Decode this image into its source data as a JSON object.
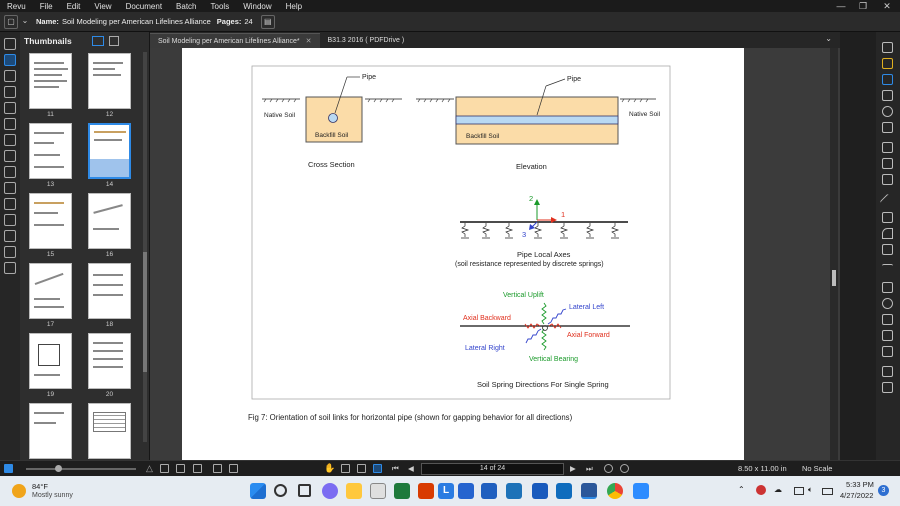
{
  "menu": {
    "items": [
      "Revu",
      "File",
      "Edit",
      "View",
      "Document",
      "Batch",
      "Tools",
      "Window",
      "Help"
    ]
  },
  "window_controls": {
    "minimize": "—",
    "restore": "❐",
    "close": "✕"
  },
  "properties_bar": {
    "name_label": "Name:",
    "name_value": "Soil Modeling per American Lifelines Alliance",
    "pages_label": "Pages:",
    "pages_value": "24"
  },
  "tabs": [
    {
      "label": "Soil Modeling per American Lifelines Alliance*",
      "active": true,
      "close": "✕"
    },
    {
      "label": "B31.3 2016 ( PDFDrive )",
      "active": false
    }
  ],
  "tab_overflow": "⌄",
  "thumbnails": {
    "title": "Thumbnails",
    "pages": [
      "11",
      "12",
      "13",
      "14",
      "15",
      "16",
      "17",
      "18",
      "19",
      "20"
    ],
    "selected": "14"
  },
  "figure": {
    "cross_section": {
      "pipe_label": "Pipe",
      "native_soil": "Native Soil",
      "backfill": "Backfill Soil",
      "caption": "Cross Section"
    },
    "elevation": {
      "pipe_label": "Pipe",
      "native_soil": "Native Soil",
      "backfill": "Backfill Soil",
      "caption": "Elevation"
    },
    "local_axes": {
      "axis1": "1",
      "axis2": "2",
      "axis3": "3",
      "caption": "Pipe Local Axes",
      "subcaption": "(soil resistance represented by discrete springs)"
    },
    "spring_directions": {
      "vertical_uplift": "Vertical Uplift",
      "lateral_left": "Lateral Left",
      "axial_backward": "Axial Backward",
      "axial_forward": "Axial Forward",
      "lateral_right": "Lateral Right",
      "vertical_bearing": "Vertical Bearing",
      "caption": "Soil Spring Directions For Single Spring"
    },
    "fig_caption": "Fig 7: Orientation of soil links for horizontal pipe (shown for gapping behavior for all directions)"
  },
  "colors": {
    "soil_fill": "#fbdca8",
    "pipe_fill": "#b9d9f3",
    "green": "#1a9a2a",
    "red": "#e0301e",
    "blue": "#3344cc",
    "accent": "#2e8ae6"
  },
  "status": {
    "page_indicator": "14 of 24",
    "page_size": "8.50 x 11.00 in",
    "scale": "No Scale"
  },
  "taskbar": {
    "temperature": "84°F",
    "condition": "Mostly sunny",
    "time": "5:33 PM",
    "date": "4/27/2022",
    "notification_count": "3"
  }
}
